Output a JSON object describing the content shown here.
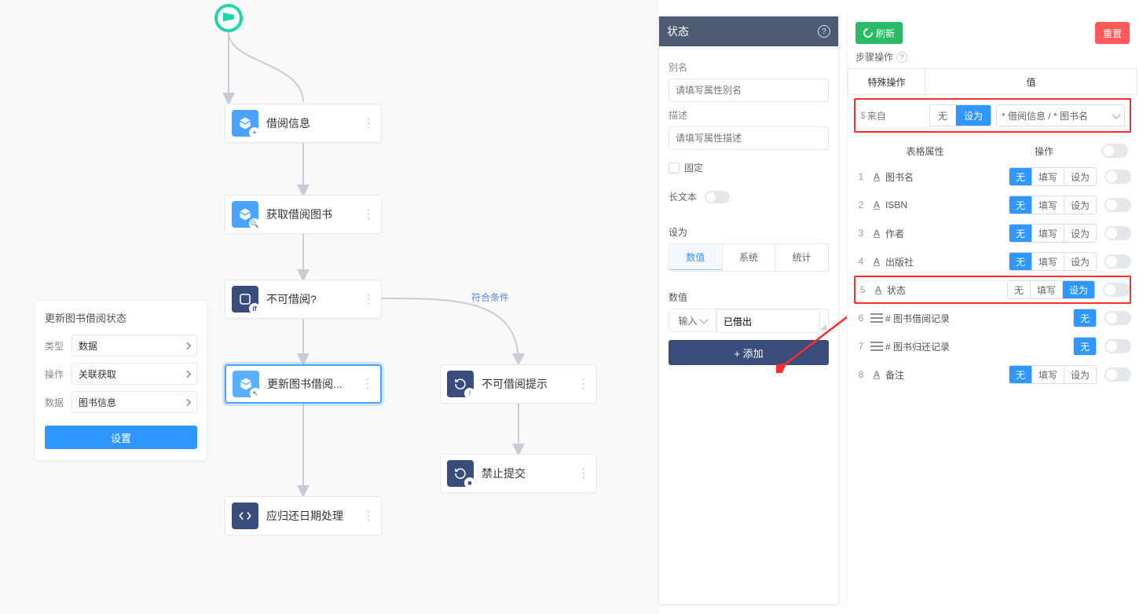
{
  "canvas": {
    "start": {},
    "edge_label": "符合条件",
    "nodes": {
      "n1": "借阅信息",
      "n2": "获取借阅图书",
      "n3": "不可借阅?",
      "n4": "更新图书借阅...",
      "n5": "不可借阅提示",
      "n6": "禁止提交",
      "n7": "应归还日期处理"
    }
  },
  "left_card": {
    "title": "更新图书借阅状态",
    "type_label": "类型",
    "type_value": "数据",
    "op_label": "操作",
    "op_value": "关联获取",
    "data_label": "数据",
    "data_value": "图书信息",
    "settings_btn": "设置"
  },
  "mid": {
    "header": "状态",
    "alias_label": "别名",
    "alias_placeholder": "请填写属性别名",
    "desc_label": "描述",
    "desc_placeholder": "请填写属性描述",
    "fixed_label": "固定",
    "longtext_label": "长文本",
    "setas_label": "设为",
    "seg": {
      "a": "数值",
      "b": "系统",
      "c": "统计"
    },
    "value_label": "数值",
    "value_mode": "输入",
    "value_text": "已借出",
    "add_btn": "+  添加"
  },
  "right": {
    "refresh": "刷新",
    "reset": "重置",
    "step_label": "步骤操作",
    "special_ops": "特殊操作",
    "value_col": "值",
    "from_label": "来自",
    "btns": {
      "none": "无",
      "setas": "设为",
      "fill": "填写"
    },
    "from_sel": "* 借阅信息 / * 图书名",
    "th_attr": "表格属性",
    "th_op": "操作",
    "rows": [
      {
        "num": "1",
        "name": "图书名",
        "kind": "text",
        "mode": "none3"
      },
      {
        "num": "2",
        "name": "ISBN",
        "kind": "text",
        "mode": "none3"
      },
      {
        "num": "3",
        "name": "作者",
        "kind": "text",
        "mode": "none3"
      },
      {
        "num": "4",
        "name": "出版社",
        "kind": "text",
        "mode": "none3"
      },
      {
        "num": "5",
        "name": "状态",
        "kind": "text",
        "mode": "setas"
      },
      {
        "num": "6",
        "name": "# 图书借阅记录",
        "kind": "rel",
        "mode": "none1"
      },
      {
        "num": "7",
        "name": "# 图书归还记录",
        "kind": "rel",
        "mode": "none1"
      },
      {
        "num": "8",
        "name": "备注",
        "kind": "text",
        "mode": "none3"
      }
    ]
  }
}
